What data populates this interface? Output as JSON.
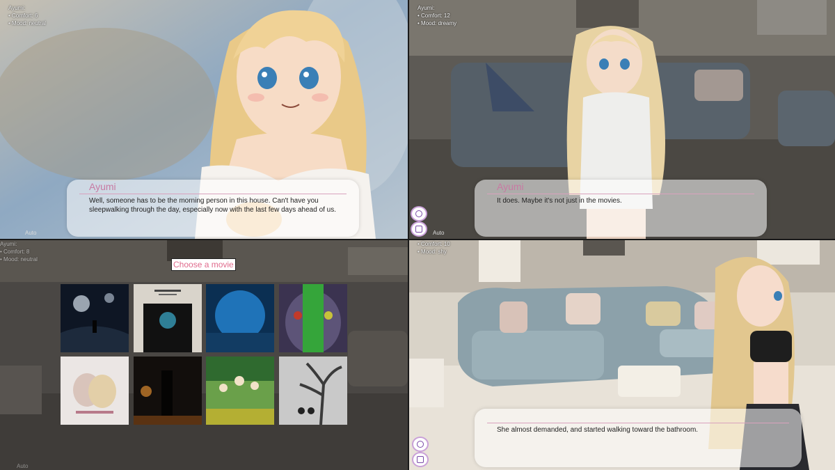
{
  "panel1": {
    "stats": {
      "title": "Ayumi:",
      "comfort": "• Comfort: 6",
      "mood": "• Mood: neutral"
    },
    "dialogue": {
      "name": "Ayumi",
      "text": "Well, someone has to be the morning person in this house. Can't have you sleepwalking through the day, especially now with the last few days ahead of us."
    },
    "auto_label": "Auto"
  },
  "panel2": {
    "stats": {
      "title": "Ayumi:",
      "comfort": "• Comfort: 12",
      "mood": "• Mood: dreamy"
    },
    "dialogue": {
      "name": "Ayumi",
      "text": "It does. Maybe it's not just in the movies."
    },
    "auto_label": "Auto"
  },
  "panel3": {
    "stats": {
      "title": "Ayumi:",
      "comfort": "• Comfort: 8",
      "mood": "• Mood: neutral"
    },
    "menu_title": "Choose a movie",
    "auto_label": "Auto",
    "movies": [
      {
        "icon": "space-poster"
      },
      {
        "icon": "portal-poster"
      },
      {
        "icon": "blue-planet-poster"
      },
      {
        "icon": "alien-face-poster"
      },
      {
        "icon": "romance-poster"
      },
      {
        "icon": "noir-poster"
      },
      {
        "icon": "meadow-poster"
      },
      {
        "icon": "winter-tree-poster"
      }
    ]
  },
  "panel4": {
    "stats": {
      "comfort": "• Comfort: 10",
      "mood": "• Mood: shy"
    },
    "dialogue": {
      "text": "She almost demanded, and started walking toward the bathroom."
    }
  },
  "colors": {
    "name_pink": "#c87aa3",
    "title_pink": "#e06a8c",
    "ui_purple": "#7a4aa8"
  }
}
